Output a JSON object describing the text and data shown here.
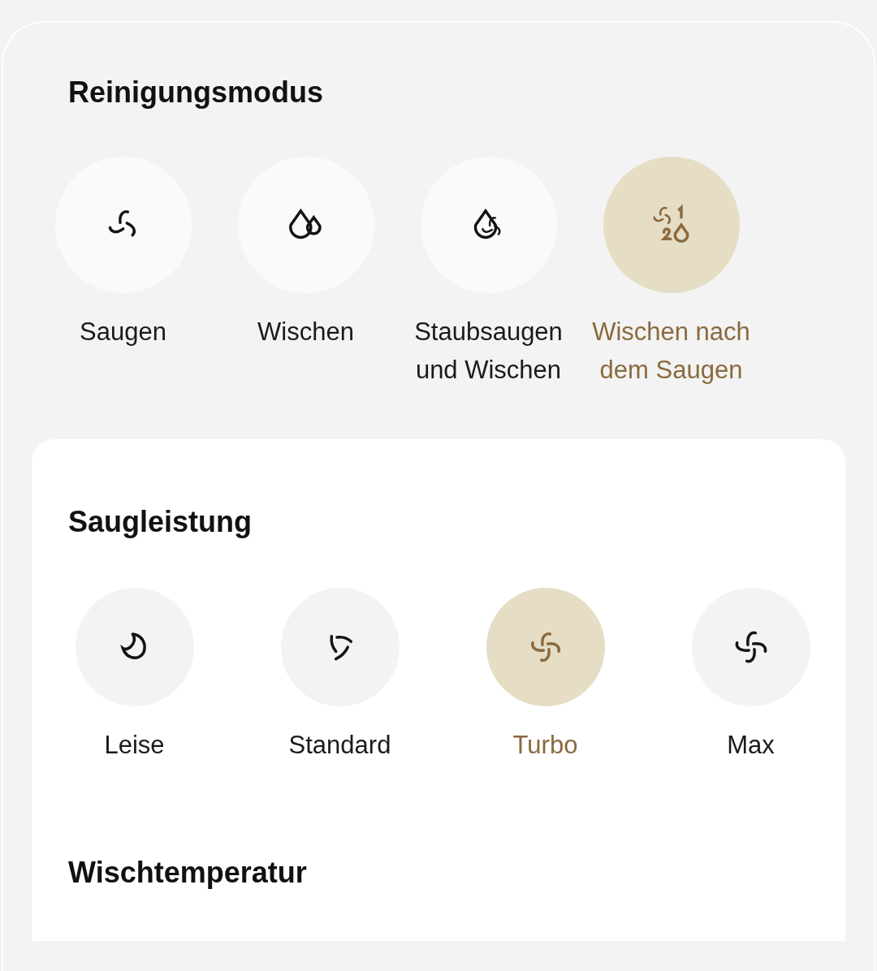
{
  "cleaning_mode": {
    "title": "Reinigungsmodus",
    "options": [
      {
        "label": "Saugen",
        "selected": false
      },
      {
        "label": "Wischen",
        "selected": false
      },
      {
        "label": "Staubsaugen und Wischen",
        "selected": false
      },
      {
        "label": "Wischen nach dem Saugen",
        "selected": true
      }
    ]
  },
  "suction_power": {
    "title": "Saugleistung",
    "options": [
      {
        "label": "Leise",
        "selected": false
      },
      {
        "label": "Standard",
        "selected": false
      },
      {
        "label": "Turbo",
        "selected": true
      },
      {
        "label": "Max",
        "selected": false
      }
    ]
  },
  "mop_temperature": {
    "title": "Wischtemperatur"
  }
}
